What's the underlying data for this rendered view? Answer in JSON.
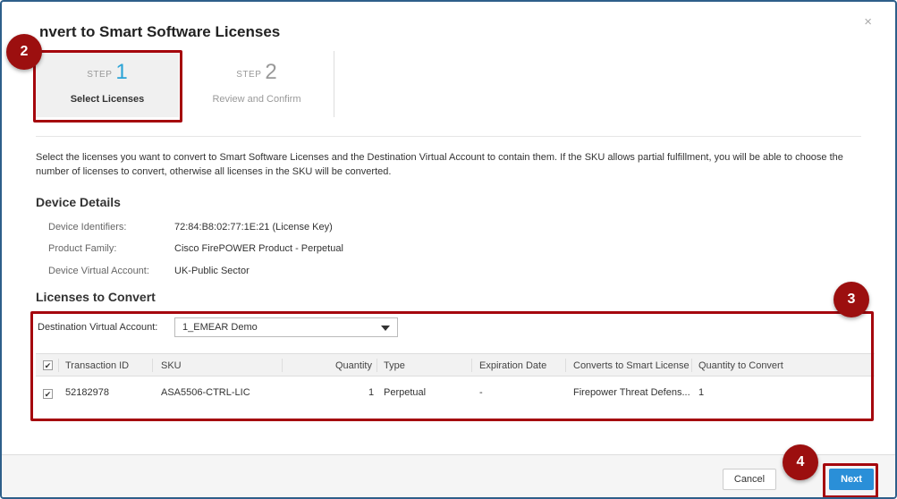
{
  "dialog": {
    "title": "nvert to Smart Software Licenses",
    "close_glyph": "×"
  },
  "steps": [
    {
      "prefix": "STEP",
      "number": "1",
      "label": "Select Licenses",
      "active": true
    },
    {
      "prefix": "STEP",
      "number": "2",
      "label": "Review and Confirm",
      "active": false
    }
  ],
  "intro_text": "Select the licenses you want to convert to Smart Software Licenses and the Destination Virtual Account to contain them. If the SKU allows partial fulfillment, you will be able to choose the number of licenses to convert, otherwise all licenses in the SKU will be converted.",
  "device_details": {
    "heading": "Device Details",
    "rows": [
      {
        "label": "Device Identifiers:",
        "value": "72:84:B8:02:77:1E:21 (License Key)"
      },
      {
        "label": "Product Family:",
        "value": "Cisco FirePOWER Product - Perpetual"
      },
      {
        "label": "Device Virtual Account:",
        "value": "UK-Public Sector"
      }
    ]
  },
  "licenses": {
    "heading": "Licenses to Convert",
    "dest_label": "Destination Virtual Account:",
    "dest_value": "1_EMEAR Demo",
    "columns": [
      "Transaction ID",
      "SKU",
      "Quantity",
      "Type",
      "Expiration Date",
      "Converts to Smart License",
      "Quantity to Convert"
    ],
    "rows": [
      {
        "transaction_id": "52182978",
        "sku": "ASA5506-CTRL-LIC",
        "quantity": "1",
        "type": "Perpetual",
        "expiration": "-",
        "converts_to": "Firepower Threat Defens...",
        "qty_to_convert": "1"
      }
    ]
  },
  "buttons": {
    "cancel": "Cancel",
    "next": "Next"
  },
  "annotations": {
    "badge_2": "2",
    "badge_3": "3",
    "badge_4": "4",
    "color": "#9c0f0f"
  },
  "colors": {
    "accent": "#2aa3d6",
    "primary_button": "#2a8fd8",
    "frame_border": "#2e5f8a"
  },
  "icons": {
    "checkbox_checked": "✔",
    "dropdown": "caret-down-icon"
  }
}
